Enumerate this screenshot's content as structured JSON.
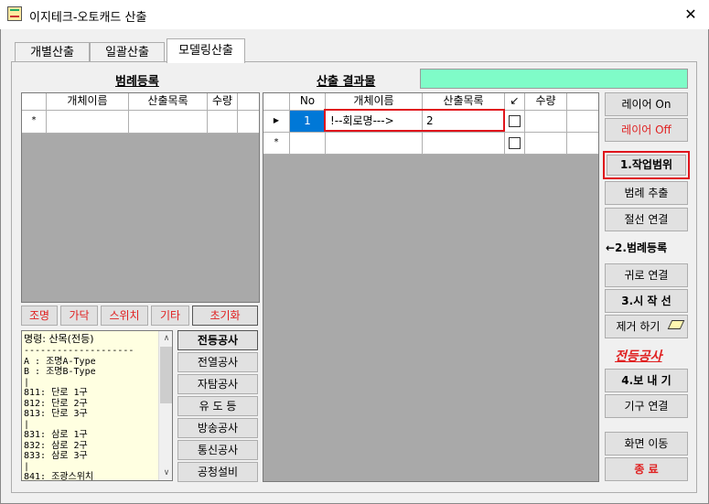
{
  "window": {
    "title": "이지테크-오토캐드 산출",
    "close": "✕"
  },
  "tabs": [
    "개별산출",
    "일괄산출",
    "모델링산출"
  ],
  "legend": {
    "title": "범례등록",
    "columns": [
      "개체이름",
      "산출목록",
      "수량"
    ],
    "new_row_marker": "*"
  },
  "results": {
    "title": "산출 결과물",
    "columns": [
      "No",
      "개체이름",
      "산출목록",
      "↙",
      "수량"
    ],
    "rows": [
      {
        "no": "1",
        "name": "!--회로명--->",
        "item": "2",
        "marker": "▶"
      }
    ],
    "new_row_marker": "*"
  },
  "category_buttons": [
    "조명",
    "가닥",
    "스위치",
    "기타",
    "초기화"
  ],
  "command_text": [
    "명령: 산목(전등)",
    "--------------------",
    "A : 조명A-Type",
    "B : 조명B-Type",
    "|",
    "811: 단로 1구",
    "812: 단로 2구",
    "813: 단로 3구",
    "|",
    "831: 삼로 1구",
    "832: 삼로 2구",
    "833: 삼로 3구",
    "|",
    "841: 조광스위치"
  ],
  "work_buttons": [
    "전등공사",
    "전열공사",
    "자탐공사",
    "유 도 등",
    "방송공사",
    "통신공사",
    "공청설비"
  ],
  "right_panel": {
    "layer_on": "레이어 On",
    "layer_off": "레이어 Off",
    "work_range": "1.작업범위",
    "legend_extract": "범례 추출",
    "cut_connect": "절선 연결",
    "legend_register": "←2.범례등록",
    "return_connect": "귀로 연결",
    "start": "3.시 작 선",
    "remove": "제거 하기",
    "current_work": "전등공사",
    "export": "4.보 내 기",
    "fixture_connect": "기구 연결",
    "screen_move": "화면 이동",
    "exit": "종 료"
  },
  "colors": {
    "accent_red": "#e02020",
    "result_field": "#7ffcc8",
    "highlight_box": "#e0151c",
    "selected_cell": "#0078d7"
  },
  "icons": [
    "close-icon",
    "app-icon",
    "eraser-icon",
    "row-pointer-icon",
    "new-row-icon",
    "scroll-up-icon",
    "scroll-down-icon"
  ]
}
